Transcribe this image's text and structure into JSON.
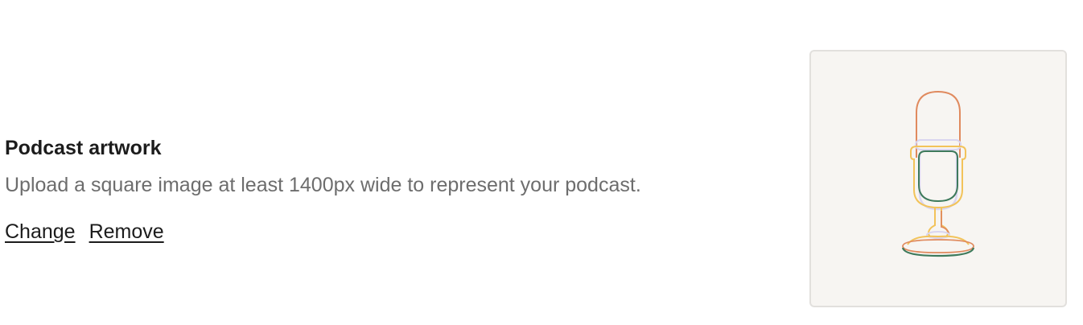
{
  "artwork_section": {
    "title": "Podcast artwork",
    "description": "Upload a square image at least 1400px wide to represent your podcast.",
    "change_label": "Change",
    "remove_label": "Remove"
  },
  "artwork_preview": {
    "icon": "microphone-icon",
    "background_color": "#f7f5f2",
    "colors": [
      "#e08a5e",
      "#f2c35a",
      "#d9d5f0",
      "#3e7a5c"
    ]
  }
}
